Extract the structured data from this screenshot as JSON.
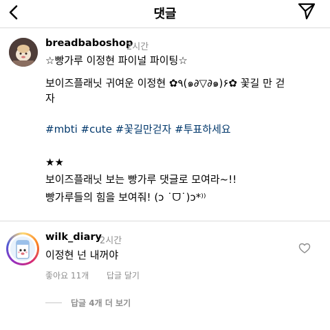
{
  "header": {
    "title": "댓글",
    "back_icon": "chevron-left-icon",
    "share_icon": "paper-plane-icon"
  },
  "post": {
    "username": "breadbaboshop",
    "time": "2시간",
    "lines": [
      "☆빵가루 이정현 파이널 파이팅☆",
      "보이즈플래닛 귀여운 이정현 ✿٩(๑∂▽∂๑)۶✿ 꽃길 만 걷",
      "자"
    ],
    "hashtags": [
      "#mbti",
      "#cute",
      "#꽃길만걷자",
      "#투표하세요"
    ],
    "stars": "★★",
    "lines2": [
      "보이즈플래닛 보는 빵가루 댓글로 모여라~!!",
      "빵가루들의 힘을 보여줘! (ɔ ˙ᗜ˙)ɔ*⁾⁾"
    ]
  },
  "comment": {
    "username": "wilk_diary",
    "time": "2시간",
    "text": "이정현 넌 내꺼야",
    "likes": "좋아요 11개",
    "reply": "답글 달기",
    "view_replies": "답글 4개 더 보기",
    "like_icon": "heart-icon"
  },
  "colors": {
    "hashtag": "#00376b",
    "muted": "#8e8e8e",
    "divider": "#dbdbdb"
  }
}
